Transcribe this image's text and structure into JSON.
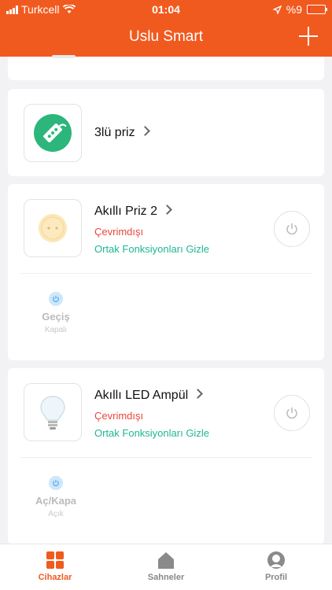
{
  "status": {
    "carrier": "Turkcell",
    "time": "01:04",
    "battery": "%9"
  },
  "header": {
    "title": "Uslu Smart"
  },
  "devices": [
    {
      "name": "3lü priz"
    },
    {
      "name": "Akıllı Priz 2",
      "status": "Çevrimdışı",
      "toggle_label": "Ortak Fonksiyonları Gizle",
      "function": {
        "label": "Geçiş",
        "state": "Kapalı"
      }
    },
    {
      "name": "Akıllı LED Ampül",
      "status": "Çevrimdışı",
      "toggle_label": "Ortak Fonksiyonları Gizle",
      "function": {
        "label": "Aç/Kapa",
        "state": "Açık"
      }
    }
  ],
  "tabs": [
    {
      "label": "Cihazlar",
      "icon": "grid-icon"
    },
    {
      "label": "Sahneler",
      "icon": "home-icon"
    },
    {
      "label": "Profil",
      "icon": "profile-icon"
    }
  ],
  "colors": {
    "accent": "#f15a1f",
    "offline": "#e9473c",
    "link": "#1fb691"
  }
}
